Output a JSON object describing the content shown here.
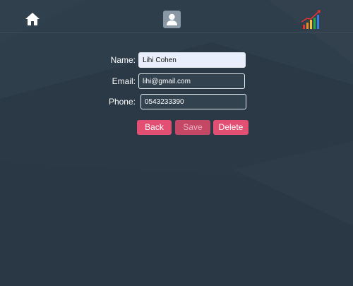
{
  "nav": {
    "home_icon": "home-icon",
    "profile_icon": "user-icon",
    "stats_icon": "growth-chart-icon"
  },
  "form": {
    "name_label": "Name:",
    "name_value": "Lihi Cohen",
    "email_label": "Email:",
    "email_value": "lihi@gmail.com",
    "phone_label": "Phone:",
    "phone_value": "0543233390"
  },
  "buttons": {
    "back": "Back",
    "save": "Save",
    "delete": "Delete"
  },
  "colors": {
    "background": "#2c3a47",
    "accent": "#e34f73",
    "disabled_accent": "#c44866"
  }
}
